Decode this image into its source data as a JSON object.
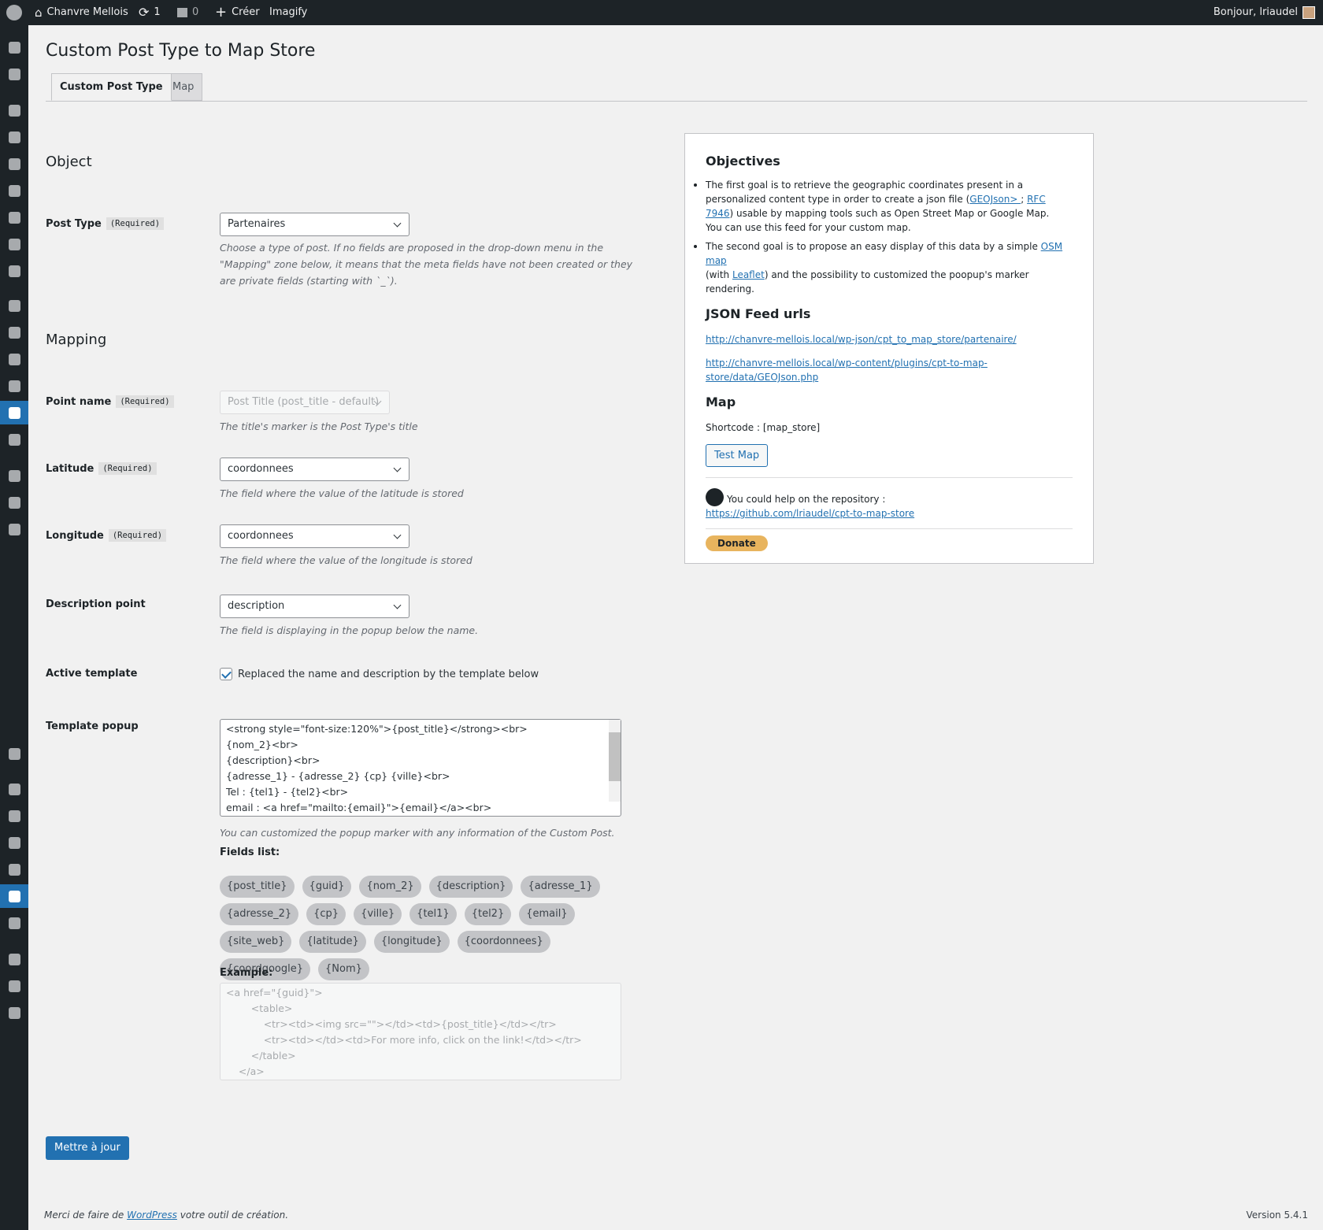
{
  "adminbar": {
    "site": "Chanvre Mellois",
    "updates": "1",
    "comments": "0",
    "new": "Créer",
    "imagify": "Imagify",
    "greeting": "Bonjour, lriaudel"
  },
  "sidebar": {
    "icons": [
      "dashboard-icon",
      "shield-icon",
      "pin-icon",
      "plugin-flame-icon",
      "media-icon",
      "pages-icon",
      "comments-icon",
      "forms-icon",
      "mail-icon",
      "tools-icon",
      "plugins-icon",
      "users-icon",
      "settings-icon",
      "cpt-map-icon",
      "table-icon",
      "plugins-icon",
      "gauge-icon",
      "play-icon",
      "mail-icon",
      "tools-icon",
      "plugins-icon",
      "users-icon",
      "settings-icon",
      "cpt-map-icon",
      "table-icon",
      "plugins-icon",
      "gauge-icon",
      "play-icon"
    ],
    "active": [
      13,
      23
    ]
  },
  "page": {
    "title": "Custom Post Type to Map Store",
    "tabs": [
      "Custom Post Type",
      "Map"
    ]
  },
  "object": {
    "heading": "Object",
    "post_type_label": "Post Type",
    "required": "(Required)",
    "post_type_value": "Partenaires",
    "post_type_desc": "Choose a type of post. If no fields are proposed in the drop-down menu in the \"Mapping\" zone below, it means that the meta fields have not been created or they are private fields (starting with `_`)."
  },
  "mapping": {
    "heading": "Mapping",
    "point_name": {
      "label": "Point name",
      "value": "Post Title (post_title - default)",
      "desc": "The title's marker is the Post Type's title"
    },
    "latitude": {
      "label": "Latitude",
      "value": "coordonnees",
      "desc": "The field where the value of the latitude is stored"
    },
    "longitude": {
      "label": "Longitude",
      "value": "coordonnees",
      "desc": "The field where the value of the longitude is stored"
    },
    "description": {
      "label": "Description point",
      "value": "description",
      "desc": "The field is displaying in the popup below the name."
    },
    "active_template": {
      "label": "Active template",
      "checked": true,
      "text": "Replaced the name and description by the template below"
    },
    "template": {
      "label": "Template popup",
      "value": "<strong style=\"font-size:120%\">{post_title}</strong><br>\n{nom_2}<br>\n{description}<br>\n{adresse_1} - {adresse_2} {cp} {ville}<br>\nTel : {tel1} - {tel2}<br>\nemail : <a href=\"mailto:{email}\">{email}</a><br>",
      "desc": "You can customized the popup marker with any information of the Custom Post.",
      "fields_label": "Fields list:",
      "fields": [
        "{post_title}",
        "{guid}",
        "{nom_2}",
        "{description}",
        "{adresse_1}",
        "{adresse_2}",
        "{cp}",
        "{ville}",
        "{tel1}",
        "{tel2}",
        "{email}",
        "{site_web}",
        "{latitude}",
        "{longitude}",
        "{coordonnees}",
        "{coordgoogle}",
        "{Nom}"
      ],
      "example_label": "Example:",
      "example": "<a href=\"{guid}\">\n\t\t<table>\n\t\t\t<tr><td><img src=\"\"></td><td>{post_title}</td></tr>\n\t\t\t<tr><td></td><td>For more info, click on the link!</td></tr>\n\t\t</table>\n\t</a>"
    }
  },
  "submit": "Mettre à jour",
  "panel": {
    "objectives": "Objectives",
    "goal1_a": "The first goal is to retrieve the geographic coordinates present in a personalized content type in order to create a json file (",
    "geojson": "GEOJson> ",
    "sep": "; ",
    "rfc": "RFC 7946",
    "goal1_b": ") usable by mapping tools such as Open Street Map or Google Map.",
    "goal1_c": "You can use this feed for your custom map.",
    "goal2_a": "The second goal is to propose an easy display of this data by a simple ",
    "osm": "OSM map",
    "goal2_b": "(with ",
    "leaflet": "Leaflet",
    "goal2_c": ") and the possibility to customized the poopup's marker rendering.",
    "json_heading": "JSON Feed urls",
    "url1": "http://chanvre-mellois.local/wp-json/cpt_to_map_store/partenaire/",
    "url2": "http://chanvre-mellois.local/wp-content/plugins/cpt-to-map-store/data/GEOJson.php",
    "map_heading": "Map",
    "shortcode_label": "Shortcode : ",
    "shortcode": "[map_store]",
    "test_map": "Test Map",
    "repo_text": "You could help on the repository :",
    "repo_url": "https://github.com/lriaudel/cpt-to-map-store",
    "donate": "Donate"
  },
  "footer": {
    "text_a": "Merci de faire de ",
    "wp": "WordPress",
    "text_b": " votre outil de création.",
    "version": "Version 5.4.1"
  },
  "colors": {
    "accent": "#2271b1",
    "adminbar": "#1d2327",
    "donate": "#e8b45e"
  }
}
